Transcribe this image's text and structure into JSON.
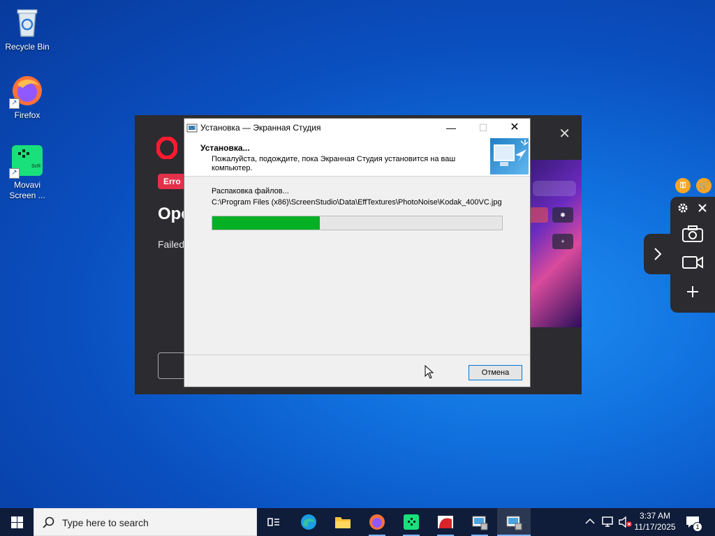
{
  "desktop": {
    "icons": [
      {
        "label": "Recycle Bin"
      },
      {
        "label": "Firefox"
      },
      {
        "label": "Movavi\nScreen ..."
      }
    ]
  },
  "opera_window": {
    "badge": "Erro",
    "title": "Ope",
    "text": "Failed",
    "preview_tiles": [
      "✱",
      "+"
    ]
  },
  "installer": {
    "title": "Установка — Экранная Студия",
    "header_title": "Установка...",
    "header_subtitle": "Пожалуйста, подождите, пока Экранная Студия установится на ваш компьютер.",
    "status_text": "Распаковка файлов...",
    "current_file": "C:\\Program Files (x86)\\ScreenStudio\\Data\\EffTextures\\PhotoNoise\\Kodak_400VC.jpg",
    "progress": 0.37,
    "cancel_label": "Отмена"
  },
  "capture_widget": {
    "icons": [
      "key-icon",
      "cart-icon",
      "gear-icon",
      "close-icon",
      "camera-icon",
      "video-icon",
      "plus-icon",
      "chevron-right-icon"
    ]
  },
  "taskbar": {
    "search_placeholder": "Type here to search",
    "apps": [
      "task-view",
      "edge",
      "file-explorer",
      "firefox",
      "movavi",
      "app-red",
      "installer",
      "installer-active"
    ],
    "clock_time": "3:37 AM",
    "clock_date": "11/17/2025",
    "notification_count": "1"
  },
  "colors": {
    "progress_fill": "#06b025",
    "opera_bg": "#2b2b30",
    "taskbar_bg": "#0f1c3a",
    "accent": "#0078d7"
  }
}
